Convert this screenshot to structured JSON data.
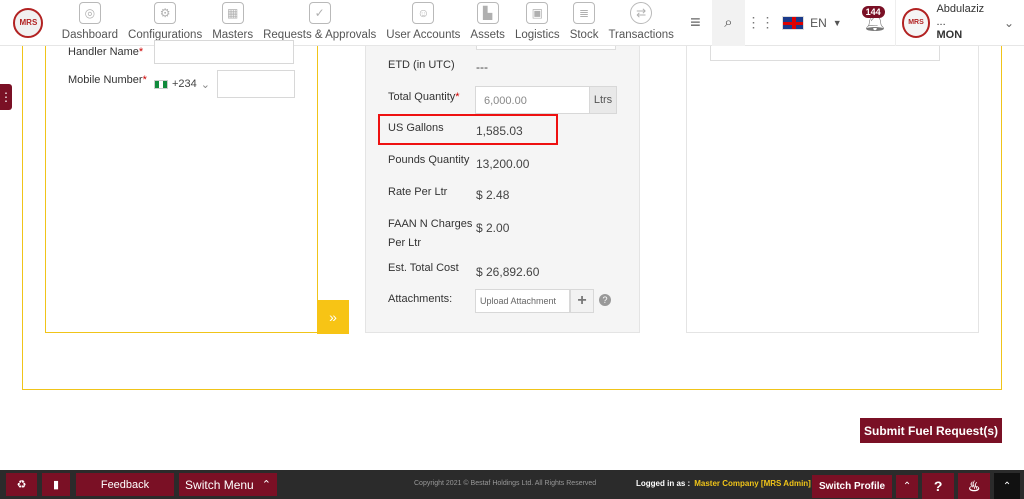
{
  "nav": {
    "items": [
      {
        "label": "Dashboard",
        "icon": "dashboard-icon"
      },
      {
        "label": "Configurations",
        "icon": "gears-icon"
      },
      {
        "label": "Masters",
        "icon": "building-icon"
      },
      {
        "label": "Requests & Approvals",
        "icon": "document-check-icon"
      },
      {
        "label": "User Accounts",
        "icon": "users-icon"
      },
      {
        "label": "Assets",
        "icon": "factory-icon"
      },
      {
        "label": "Logistics",
        "icon": "truck-icon"
      },
      {
        "label": "Stock",
        "icon": "barrels-icon"
      },
      {
        "label": "Transactions",
        "icon": "exchange-icon"
      }
    ],
    "lang": "EN",
    "notif_count": "144",
    "user_name": "Abdulaziz ...",
    "user_role": "MON",
    "logo_text": "MRS"
  },
  "left": {
    "handler_label": "Handler Name",
    "mobile_label": "Mobile Number",
    "country_code": "+234",
    "req": "*"
  },
  "mid": {
    "etd_label": "ETD (in UTC)",
    "etd_value": "---",
    "qty_label": "Total Quantity",
    "qty_value": "6,000.00",
    "qty_unit": "Ltrs",
    "usg_label": "US Gallons",
    "usg_value": "1,585.03",
    "lbs_label": "Pounds Quantity",
    "lbs_value": "13,200.00",
    "rate_label": "Rate Per Ltr",
    "rate_value": "$ 2.48",
    "faan_label_1": "FAAN N Charges",
    "faan_label_2": "Per Ltr",
    "faan_value": "$ 2.00",
    "cost_label": "Est. Total Cost",
    "cost_value": "$ 26,892.60",
    "att_label": "Attachments:",
    "att_placeholder": "Upload Attachment"
  },
  "submit_label": "Submit Fuel Request(s)",
  "footer": {
    "feedback": "Feedback",
    "switch_menu": "Switch Menu",
    "copyright": "Copyright 2021 © Bestaf Holdings Ltd. All Rights Reserved",
    "logged_label": "Logged in as :",
    "logged_value": "Master Company [MRS Admin]",
    "switch_profile": "Switch Profile"
  },
  "colors": {
    "brand": "#7a1025",
    "accent": "#f0c419",
    "highlight": "#e11111"
  }
}
